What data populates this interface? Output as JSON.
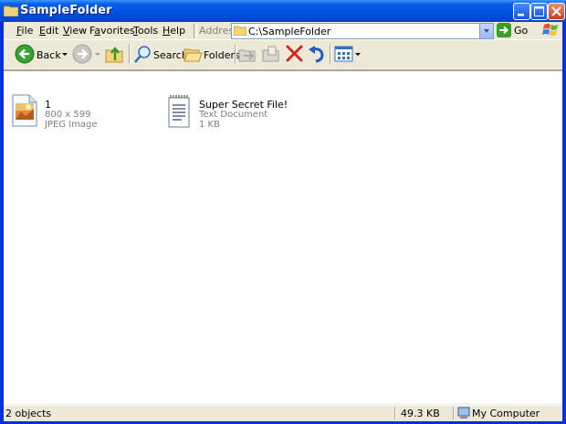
{
  "window": {
    "title": "SampleFolder",
    "controls": {
      "minimize": "minimize",
      "maximize": "maximize",
      "close": "close"
    }
  },
  "menubar": {
    "items": [
      {
        "label": "File",
        "accel": "F",
        "rest": "ile"
      },
      {
        "label": "Edit",
        "accel": "E",
        "rest": "dit"
      },
      {
        "label": "View",
        "accel": "V",
        "rest": "iew"
      },
      {
        "label": "Favorites",
        "accel": "a",
        "pre": "F",
        "rest": "vorites"
      },
      {
        "label": "Tools",
        "accel": "T",
        "rest": "ools"
      },
      {
        "label": "Help",
        "accel": "H",
        "rest": "elp"
      }
    ]
  },
  "address": {
    "label": "Address",
    "value": "C:\\SampleFolder",
    "go_label": "Go"
  },
  "toolbar": {
    "back_label": "Back",
    "search_label": "Search",
    "folders_label": "Folders"
  },
  "files": [
    {
      "name": "1",
      "line2": "800 x 599",
      "line3": "JPEG Image",
      "icon": "jpeg-image-icon"
    },
    {
      "name": "Super Secret File!",
      "line2": "Text Document",
      "line3": "1 KB",
      "icon": "text-document-icon"
    }
  ],
  "status": {
    "objects": "2 objects",
    "size": "49.3 KB",
    "zone": "My Computer"
  },
  "colors": {
    "titlebar": "#0054e3",
    "chrome": "#ece9d8",
    "content": "#ffffff"
  }
}
